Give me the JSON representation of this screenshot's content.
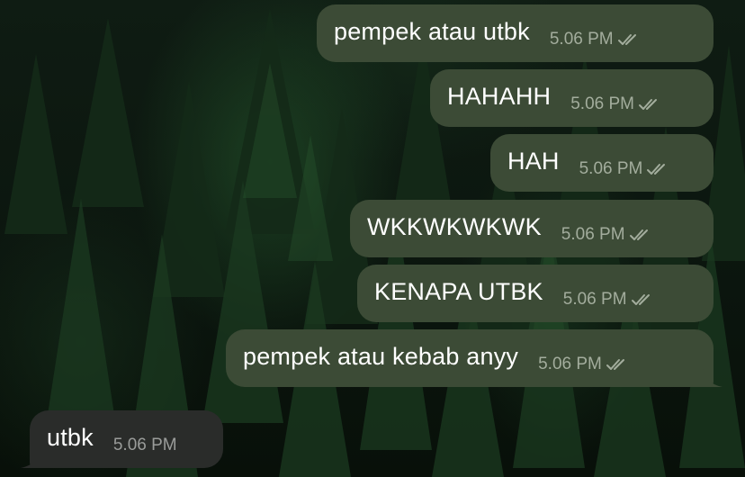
{
  "chat": {
    "messages": [
      {
        "text": "pempek atau utbk",
        "time": "5.06 PM",
        "direction": "outgoing",
        "status": "read-double-check-icon"
      },
      {
        "text": "HAHAHH",
        "time": "5.06 PM",
        "direction": "outgoing",
        "status": "read-double-check-icon"
      },
      {
        "text": "HAH",
        "time": "5.06 PM",
        "direction": "outgoing",
        "status": "read-double-check-icon"
      },
      {
        "text": "WKKWKWKWK",
        "time": "5.06 PM",
        "direction": "outgoing",
        "status": "read-double-check-icon"
      },
      {
        "text": "KENAPA UTBK",
        "time": "5.06 PM",
        "direction": "outgoing",
        "status": "read-double-check-icon"
      },
      {
        "text": "pempek atau kebab anyy",
        "time": "5.06 PM",
        "direction": "outgoing",
        "status": "read-double-check-icon"
      },
      {
        "text": "utbk",
        "time": "5.06 PM",
        "direction": "incoming"
      }
    ]
  },
  "colors": {
    "outgoing_bubble": "#3c4b36",
    "incoming_bubble": "#2a2c2a",
    "timestamp_outgoing": "#a3ad9d",
    "timestamp_incoming": "#9a9c9a",
    "wallpaper": "#0d1810"
  }
}
